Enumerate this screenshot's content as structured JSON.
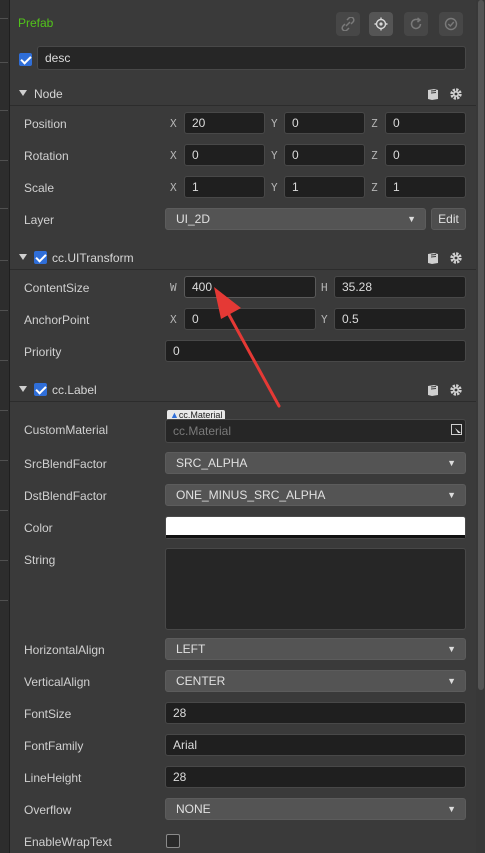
{
  "prefab": {
    "title": "Prefab"
  },
  "name_field": {
    "value": "desc",
    "enabled": true
  },
  "node": {
    "title": "Node",
    "position": {
      "label": "Position",
      "x": "20",
      "y": "0",
      "z": "0"
    },
    "rotation": {
      "label": "Rotation",
      "x": "0",
      "y": "0",
      "z": "0"
    },
    "scale": {
      "label": "Scale",
      "x": "1",
      "y": "1",
      "z": "1"
    },
    "layer": {
      "label": "Layer",
      "value": "UI_2D",
      "edit_label": "Edit"
    }
  },
  "axes": {
    "x": "X",
    "y": "Y",
    "z": "Z",
    "w": "W",
    "h": "H"
  },
  "uitransform": {
    "title": "cc.UITransform",
    "content_size": {
      "label": "ContentSize",
      "w": "400",
      "h": "35.28"
    },
    "anchor_point": {
      "label": "AnchorPoint",
      "x": "0",
      "y": "0.5"
    },
    "priority": {
      "label": "Priority",
      "value": "0"
    }
  },
  "label_component": {
    "title": "cc.Label",
    "custom_material": {
      "label": "CustomMaterial",
      "tag": "cc.Material",
      "placeholder": "cc.Material"
    },
    "src_blend_factor": {
      "label": "SrcBlendFactor",
      "value": "SRC_ALPHA"
    },
    "dst_blend_factor": {
      "label": "DstBlendFactor",
      "value": "ONE_MINUS_SRC_ALPHA"
    },
    "color": {
      "label": "Color",
      "value": "#FFFFFF"
    },
    "string": {
      "label": "String",
      "value": ""
    },
    "horizontal_align": {
      "label": "HorizontalAlign",
      "value": "LEFT"
    },
    "vertical_align": {
      "label": "VerticalAlign",
      "value": "CENTER"
    },
    "font_size": {
      "label": "FontSize",
      "value": "28"
    },
    "font_family": {
      "label": "FontFamily",
      "value": "Arial"
    },
    "line_height": {
      "label": "LineHeight",
      "value": "28"
    },
    "overflow": {
      "label": "Overflow",
      "value": "NONE"
    },
    "enable_wrap_text": {
      "label": "EnableWrapText",
      "checked": false
    }
  },
  "colors": {
    "accent_green": "#52c41a",
    "checkbox_blue": "#2f6ed8",
    "annotation_red": "#e53935"
  },
  "icons": [
    "unlink-icon",
    "locate-icon",
    "refresh-icon",
    "check-circle-icon",
    "book-icon",
    "gear-icon",
    "dropdown-arrow-icon",
    "asset-picker-icon"
  ]
}
